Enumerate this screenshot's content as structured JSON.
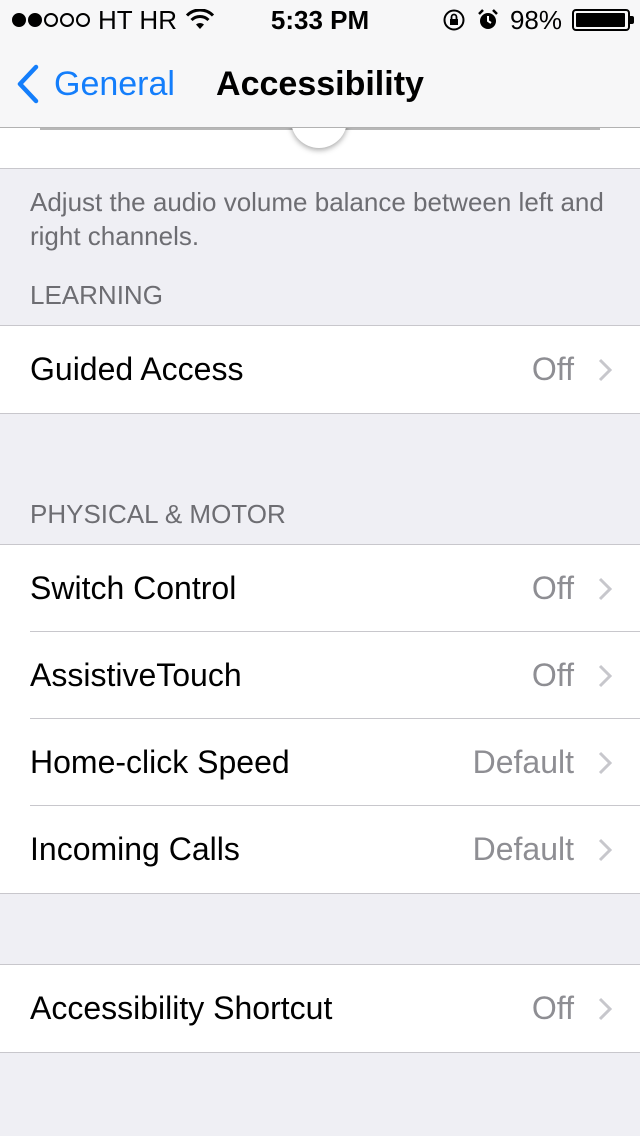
{
  "status_bar": {
    "carrier": "HT HR",
    "time": "5:33 PM",
    "battery_percent": "98%",
    "battery_level": 0.98,
    "signal_strength": 2,
    "signal_total": 5
  },
  "nav": {
    "back_label": "General",
    "title": "Accessibility"
  },
  "balance": {
    "description": "Adjust the audio volume balance between left and right channels.",
    "slider_value": 0.5
  },
  "sections": {
    "learning": {
      "header": "LEARNING",
      "items": [
        {
          "label": "Guided Access",
          "value": "Off"
        }
      ]
    },
    "physical_motor": {
      "header": "PHYSICAL & MOTOR",
      "items": [
        {
          "label": "Switch Control",
          "value": "Off"
        },
        {
          "label": "AssistiveTouch",
          "value": "Off"
        },
        {
          "label": "Home-click Speed",
          "value": "Default"
        },
        {
          "label": "Incoming Calls",
          "value": "Default"
        }
      ]
    },
    "shortcut": {
      "items": [
        {
          "label": "Accessibility Shortcut",
          "value": "Off"
        }
      ]
    }
  },
  "colors": {
    "accent": "#147efb",
    "background": "#efeff4",
    "secondary_text": "#8e8e93"
  }
}
